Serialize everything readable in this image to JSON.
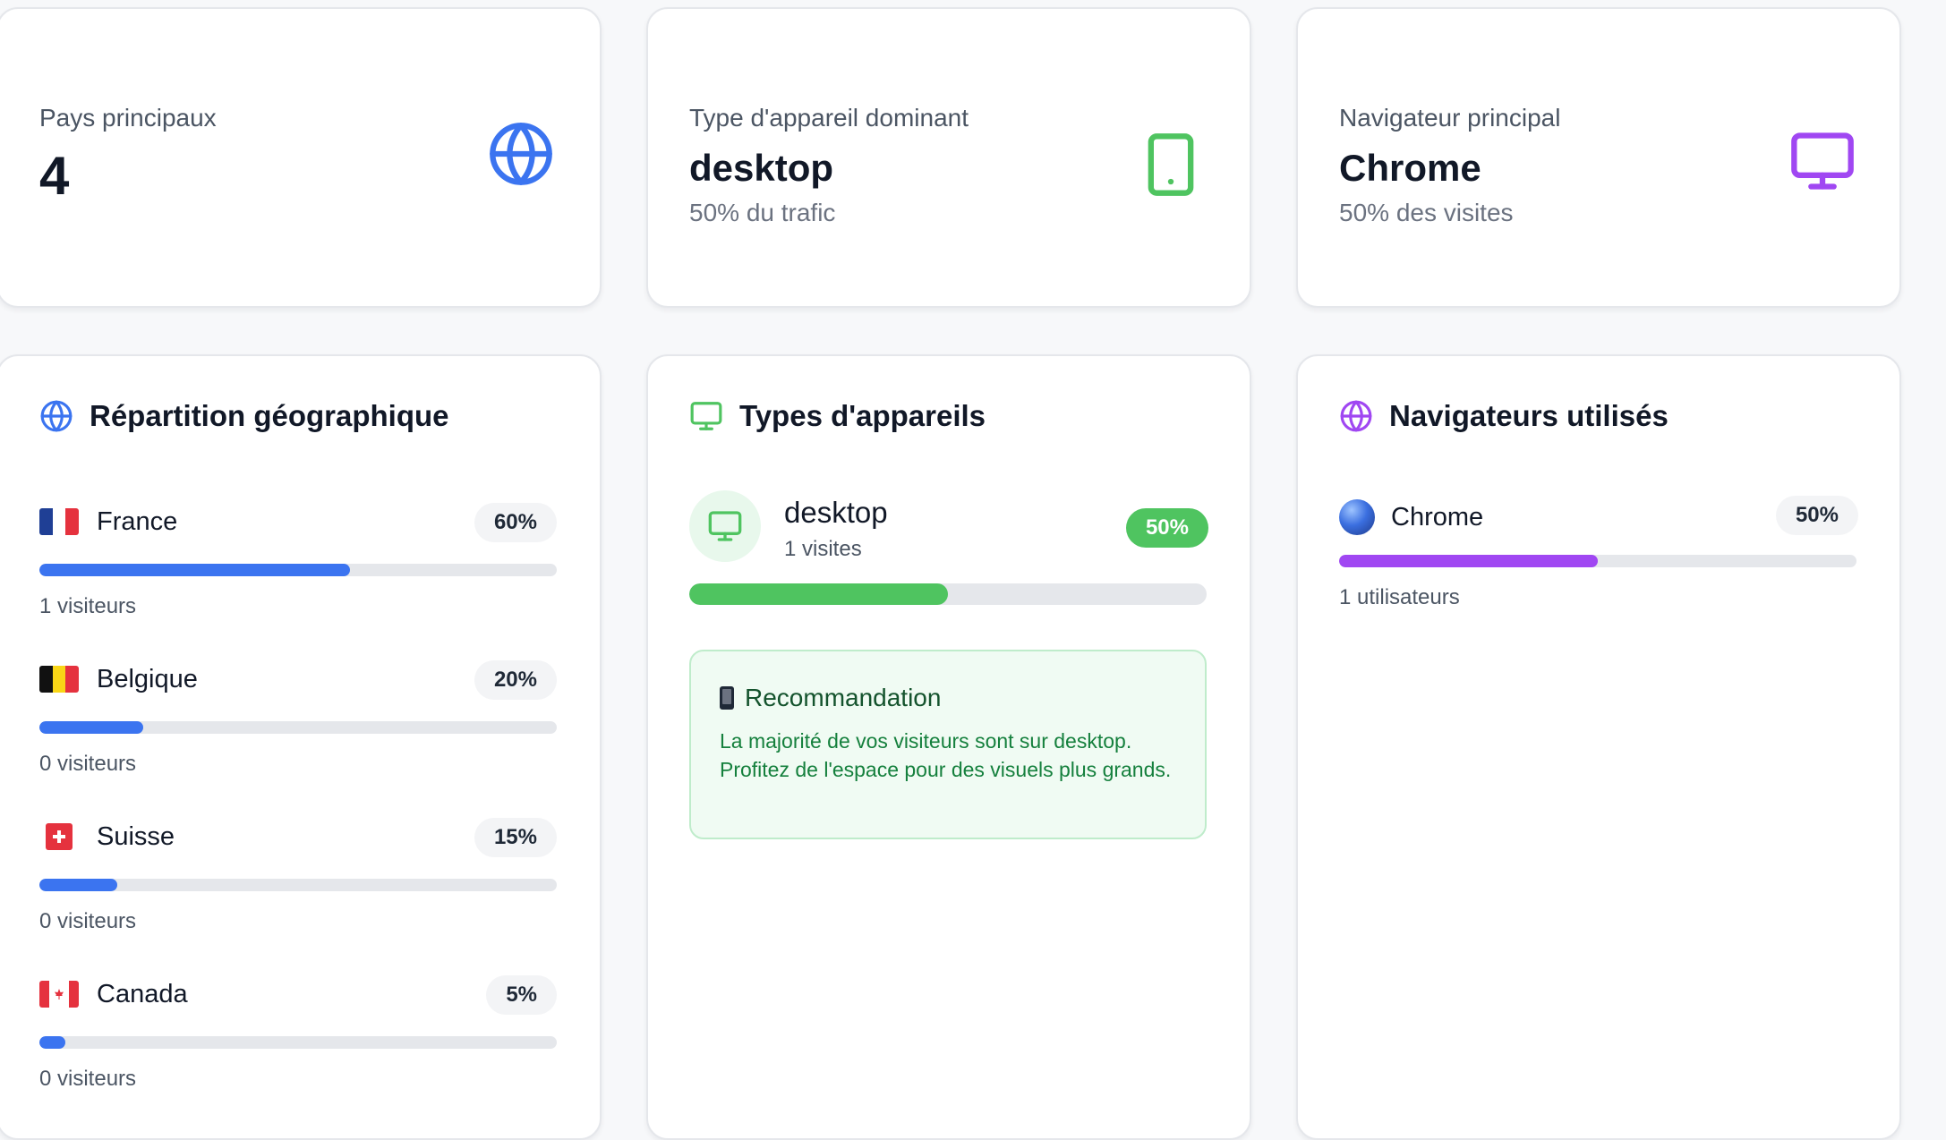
{
  "colors": {
    "blue": "#3b74f0",
    "green": "#4fc460",
    "purple": "#a047f2",
    "badge_green": "#4fc460"
  },
  "stats": [
    {
      "label": "Pays principaux",
      "value": "4",
      "sub": "",
      "icon": "globe-icon"
    },
    {
      "label": "Type d'appareil dominant",
      "value": "desktop",
      "sub": "50% du trafic",
      "icon": "smartphone-icon"
    },
    {
      "label": "Navigateur principal",
      "value": "Chrome",
      "sub": "50% des visites",
      "icon": "monitor-icon"
    }
  ],
  "geo": {
    "title": "Répartition géographique",
    "icon": "globe-icon",
    "countries": [
      {
        "name": "France",
        "percent": "60%",
        "fill": 0.6,
        "visitors": "1 visiteurs",
        "flag": "flag-france"
      },
      {
        "name": "Belgique",
        "percent": "20%",
        "fill": 0.2,
        "visitors": "0 visiteurs",
        "flag": "flag-belgium"
      },
      {
        "name": "Suisse",
        "percent": "15%",
        "fill": 0.15,
        "visitors": "0 visiteurs",
        "flag": "flag-switzerland"
      },
      {
        "name": "Canada",
        "percent": "5%",
        "fill": 0.05,
        "visitors": "0 visiteurs",
        "flag": "flag-canada"
      }
    ]
  },
  "devices": {
    "title": "Types d'appareils",
    "icon": "monitor-icon",
    "items": [
      {
        "name": "desktop",
        "visits": "1 visites",
        "percent": "50%",
        "fill": 0.5
      }
    ],
    "recommendation": {
      "title": "Recommandation",
      "icon": "mobile-phone-icon",
      "text": "La majorité de vos visiteurs sont sur desktop. Profitez de l'espace pour des visuels plus grands."
    }
  },
  "browsers": {
    "title": "Navigateurs utilisés",
    "icon": "globe-icon",
    "items": [
      {
        "name": "Chrome",
        "percent": "50%",
        "fill": 0.5,
        "users": "1 utilisateurs",
        "icon": "chrome-dot-icon"
      }
    ]
  }
}
